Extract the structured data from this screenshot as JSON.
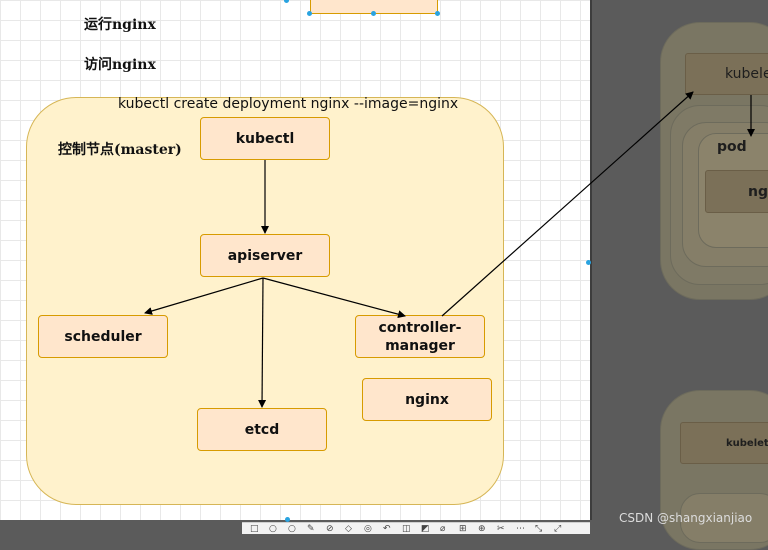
{
  "canvas": {
    "run_label": "运行nginx",
    "visit_label": "访问nginx",
    "command": "kubectl create deployment nginx --image=nginx",
    "master_label": "控制节点(master)"
  },
  "nodes": {
    "kubectl": "kubectl",
    "apiserver": "apiserver",
    "scheduler": "scheduler",
    "controller_manager_line1": "controller-",
    "controller_manager_line2": "manager",
    "etcd": "etcd",
    "nginx": "nginx"
  },
  "worker": {
    "kubelet": "kubelet",
    "pod": "pod",
    "ng": "ng",
    "kubelet2": "kubelet"
  },
  "toolbar": {
    "icons": [
      "□",
      "○",
      "○",
      "✎",
      "⊘",
      "◇",
      "◎",
      "↶",
      "◫",
      "◩",
      "⌀",
      "⊞",
      "⊕",
      "✂",
      "⋯",
      "⤡",
      "⤢"
    ]
  },
  "watermark": "CSDN @shangxianjiao",
  "colors": {
    "container_fill": "#fff2cc",
    "container_border": "#d6b656",
    "node_fill": "#ffe6cc",
    "node_border": "#d79b00",
    "selection_handle": "#29a3e0"
  }
}
